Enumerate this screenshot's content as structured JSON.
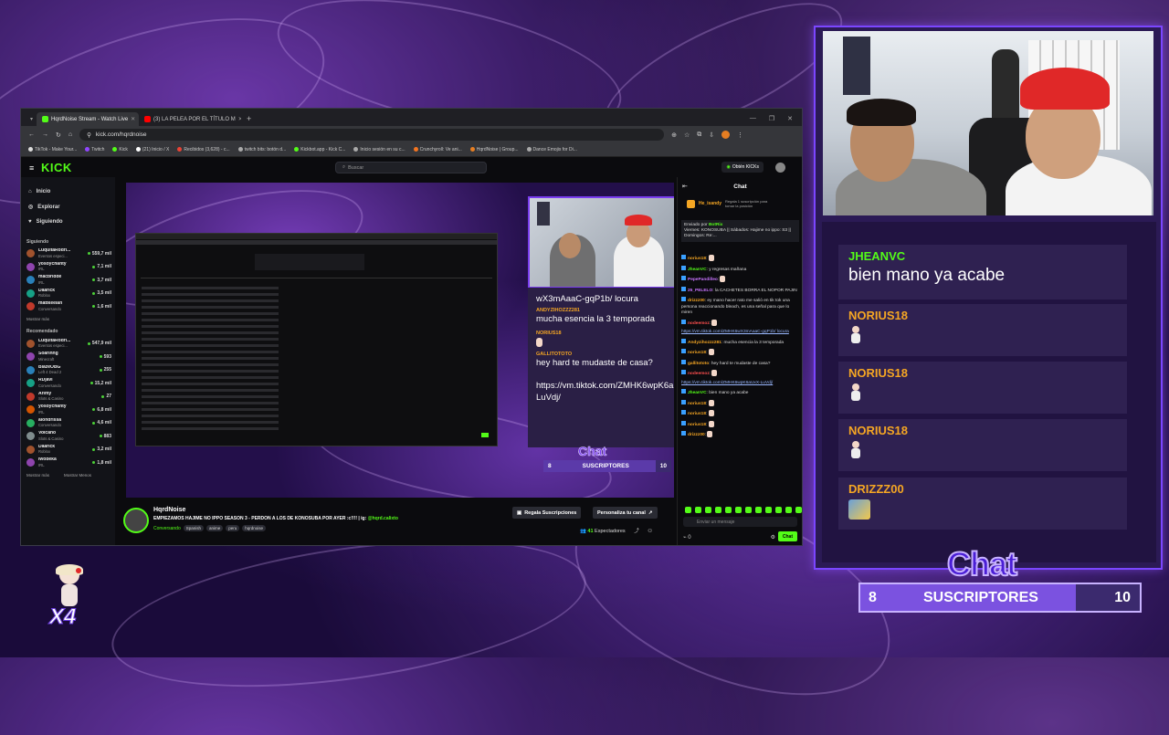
{
  "browser": {
    "tabs": [
      {
        "label": "HqrdNoise Stream - Watch Live",
        "color": "#53fc18",
        "active": true
      },
      {
        "label": "(3) LA PELEA POR EL TÍTULO M",
        "color": "#ff0000",
        "active": false
      }
    ],
    "url": "kick.com/hqrdnoise",
    "bookmarks": [
      "TikTok - Make Your...",
      "Twitch",
      "Kick",
      "(21) Inicio / X",
      "Recibidos (3,628) - c...",
      "twitch bits: botón d...",
      "Kickbot.app - Kick C...",
      "Inicio sesión en su c...",
      "Crunchyroll: Ve ani...",
      "HqrdNoise | Group...",
      "Dance Emojis for Di..."
    ]
  },
  "kick": {
    "logo": "KICK",
    "search_placeholder": "Buscar",
    "get_kicks": "Obtén KICKs",
    "nav": [
      {
        "label": "Inicio",
        "icon": "home-icon"
      },
      {
        "label": "Explorar",
        "icon": "compass-icon"
      },
      {
        "label": "Siguiendo",
        "icon": "heart-icon"
      }
    ],
    "following_title": "Siguiendo",
    "following": [
      {
        "name": "LuquitaRodri...",
        "cat": "Eventos especi...",
        "viewers": "559,7 mil"
      },
      {
        "name": "yosoychanty",
        "cat": "IRL",
        "viewers": "7,1 mil"
      },
      {
        "name": "macbridde",
        "cat": "IRL",
        "viewers": "3,7 mil"
      },
      {
        "name": "Daarick",
        "cat": "Roblox",
        "viewers": "3,5 mil"
      },
      {
        "name": "mattkeelan",
        "cat": "Conversando",
        "viewers": "1,6 mil"
      }
    ],
    "show_more": "Mostrar más",
    "recommended_title": "Recomendado",
    "recommended": [
      {
        "name": "LuquitaRodri...",
        "cat": "Eventos especi...",
        "viewers": "547,9 mil"
      },
      {
        "name": "Soarinng",
        "cat": "Minecraft",
        "viewers": "593"
      },
      {
        "name": "BlazeOBG",
        "cat": "Left 4 Dead 2",
        "viewers": "255"
      },
      {
        "name": "RDjavi",
        "cat": "Conversando",
        "viewers": "15,2 mil"
      },
      {
        "name": "Arimy",
        "cat": "Slots & Casino",
        "viewers": "27"
      },
      {
        "name": "yosoychanty",
        "cat": "IRL",
        "viewers": "6,8 mil"
      },
      {
        "name": "alondrissa",
        "cat": "Conversando",
        "viewers": "4,6 mil"
      },
      {
        "name": "Volcano",
        "cat": "Slots & Casino",
        "viewers": "883"
      },
      {
        "name": "Daarick",
        "cat": "Roblox",
        "viewers": "3,2 mil"
      },
      {
        "name": "iwobeka",
        "cat": "IRL",
        "viewers": "1,8 mil"
      }
    ],
    "footer_links": [
      "Mostrar más",
      "Mostrar Menos"
    ],
    "stream": {
      "name": "HqrdNoise",
      "title": "EMPIEZAMOS HAJIME NO IPPO SEASON 3 - PERDON A LOS DE KONOSUBA POR AYER :c!!!! | ig:",
      "ig": "@hqrd.calixto",
      "category": "Conversando",
      "tags": [
        "Spanish",
        "anime",
        "peru",
        "hqrdnoise"
      ],
      "gift_button": "Regala Suscripciones",
      "customize_button": "Personaliza tu canal",
      "viewers": "41",
      "viewers_label": "Espectadores"
    },
    "chat": {
      "title": "Chat",
      "gifter": "He_isandy",
      "gifter_text": "Regala 1 suscripción para tomar la posición",
      "pinned_by": "Enviado por",
      "pinned_user": "BotRix",
      "pinned_text": "Viernes: KONOSUBA || Sábados: Hajime no ippo: S3 || Domingos: Re:...",
      "messages": [
        {
          "user": "norius18",
          "cls": "u-o",
          "text": ""
        },
        {
          "user": "JheanVC",
          "cls": "u-g",
          "text": "y regresas mañana"
        },
        {
          "user": "PepePandilleo",
          "cls": "u-p",
          "text": ""
        },
        {
          "user": "25_PELELO",
          "cls": "u-p",
          "text": "la CACHETES BORRA EL NOPOR PAJIN"
        },
        {
          "user": "drizzz00",
          "cls": "u-o",
          "text": "ey mano hacer rato me salió en tik tok una persona reaccionando bleach, es una señal para que lo miren"
        },
        {
          "user": "nodeemoz",
          "cls": "u-r",
          "text": ""
        },
        {
          "user": "link1",
          "cls": "lnk",
          "text": "https://vm.tiktok.com/ZMHK6wX3mAaaC-gqP1b/ locura"
        },
        {
          "user": "Andyzihozzz281",
          "cls": "u-o",
          "text": "mucha esencia la 3 temporada"
        },
        {
          "user": "norius18",
          "cls": "u-o",
          "text": ""
        },
        {
          "user": "gallitototo",
          "cls": "u-o",
          "text": "hey hard te mudaste de casa?"
        },
        {
          "user": "nodeemoz",
          "cls": "u-r",
          "text": ""
        },
        {
          "user": "link2",
          "cls": "lnk",
          "text": "https://vm.tiktok.com/ZMHK6wpK6aUxX-LuVdj/"
        },
        {
          "user": "JheanVC",
          "cls": "u-g",
          "text": "bien mano ya acabe"
        },
        {
          "user": "norius18",
          "cls": "u-o",
          "text": ""
        },
        {
          "user": "norius18",
          "cls": "u-o",
          "text": ""
        },
        {
          "user": "norius18",
          "cls": "u-o",
          "text": ""
        },
        {
          "user": "drizzz00",
          "cls": "u-o",
          "text": ""
        }
      ],
      "input_placeholder": "Enviar un mensaje",
      "send_button": "Chat",
      "points": "0"
    }
  },
  "inner_overlay": {
    "chat_lines": [
      {
        "name": "",
        "text": "wX3mAaaC-gqP1b/ locura"
      },
      {
        "name": "ANDYZIHOZZZ281",
        "text": "mucha esencia la 3 temporada"
      },
      {
        "name": "NORIUS18",
        "text": ""
      },
      {
        "name": "GALLITOTOTO",
        "text": "hey hard te mudaste de casa?"
      },
      {
        "name": "",
        "text": "https://vm.tiktok.com/ZMHK6wpK6aUxX-LuVdj/"
      }
    ],
    "chat_label": "Chat",
    "subs_current": "8",
    "subs_label": "SUSCRIPTORES",
    "subs_goal": "10"
  },
  "overlay": {
    "messages": [
      {
        "name": "JHEANVC",
        "color": "#53fc18",
        "text": "bien mano ya acabe"
      },
      {
        "name": "NORIUS18",
        "color": "#f5a623",
        "text": ""
      },
      {
        "name": "NORIUS18",
        "color": "#f5a623",
        "text": ""
      },
      {
        "name": "NORIUS18",
        "color": "#f5a623",
        "text": ""
      },
      {
        "name": "DRIZZZ00",
        "color": "#f5a623",
        "text": ""
      }
    ],
    "chat_label": "Chat",
    "subs_current": "8",
    "subs_label": "SUSCRIPTORES",
    "subs_goal": "10",
    "badge": "X4"
  }
}
